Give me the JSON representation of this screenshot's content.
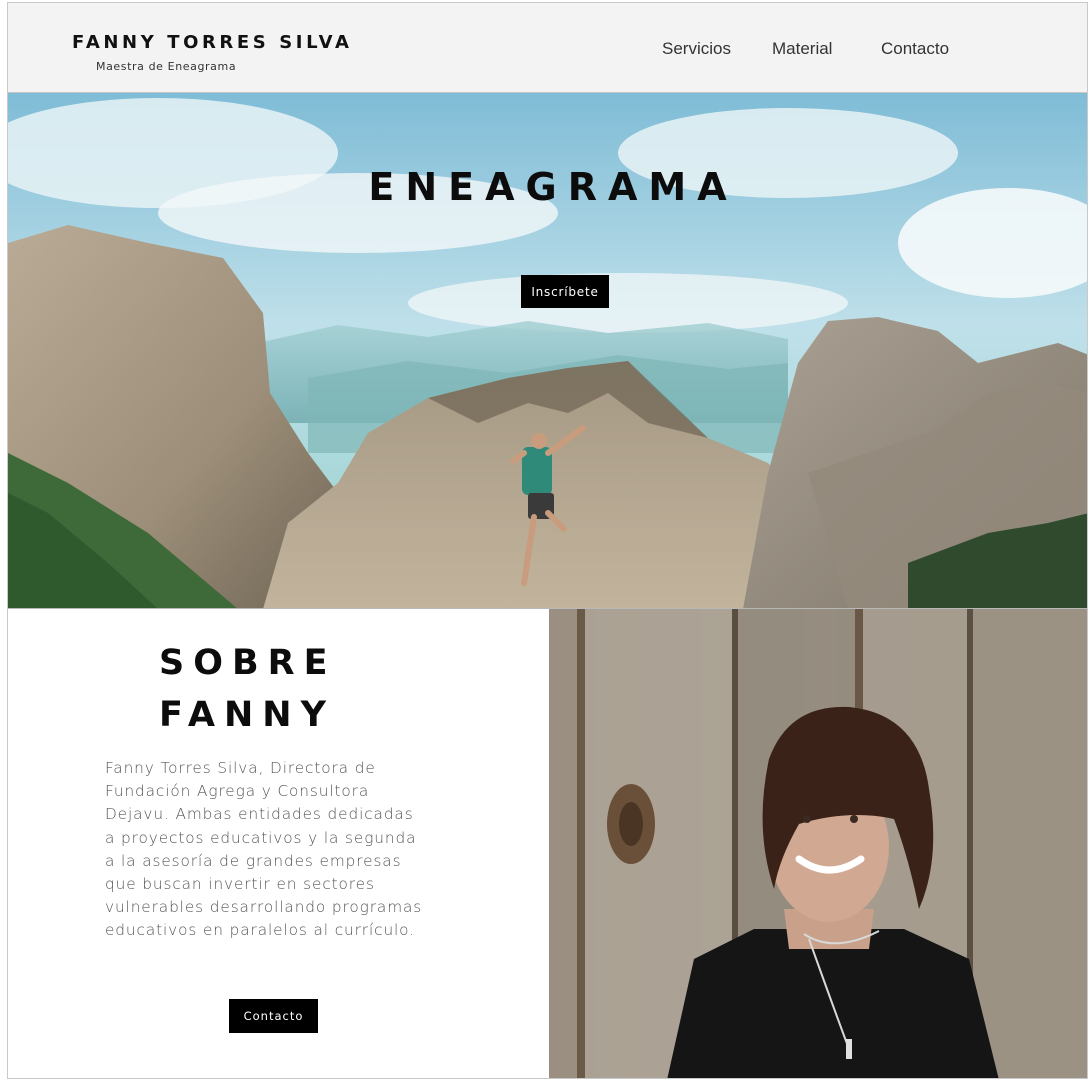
{
  "header": {
    "brand_name": "FANNY TORRES SILVA",
    "brand_subtitle": "Maestra de Eneagrama",
    "nav": [
      {
        "label": "Servicios"
      },
      {
        "label": "Material"
      },
      {
        "label": "Contacto"
      }
    ]
  },
  "hero": {
    "title": "ENEAGRAMA",
    "cta_label": "Inscríbete"
  },
  "about": {
    "title_line1": "SOBRE",
    "title_line2": "FANNY",
    "body_lines": [
      "Fanny Torres Silva, Directora de",
      "Fundación Agrega y Consultora",
      "Dejavu. Ambas entidades dedicadas",
      "a proyectos educativos y la segunda",
      "a la asesoría de grandes empresas",
      "que buscan invertir en sectores",
      "vulnerables desarrollando programas",
      "educativos en paralelos al currículo."
    ],
    "cta_label": "Contacto"
  },
  "colors": {
    "header_bg": "#f3f3f3",
    "button_bg": "#000000",
    "sky": "#9fcfe0",
    "rock": "#a89a86"
  }
}
